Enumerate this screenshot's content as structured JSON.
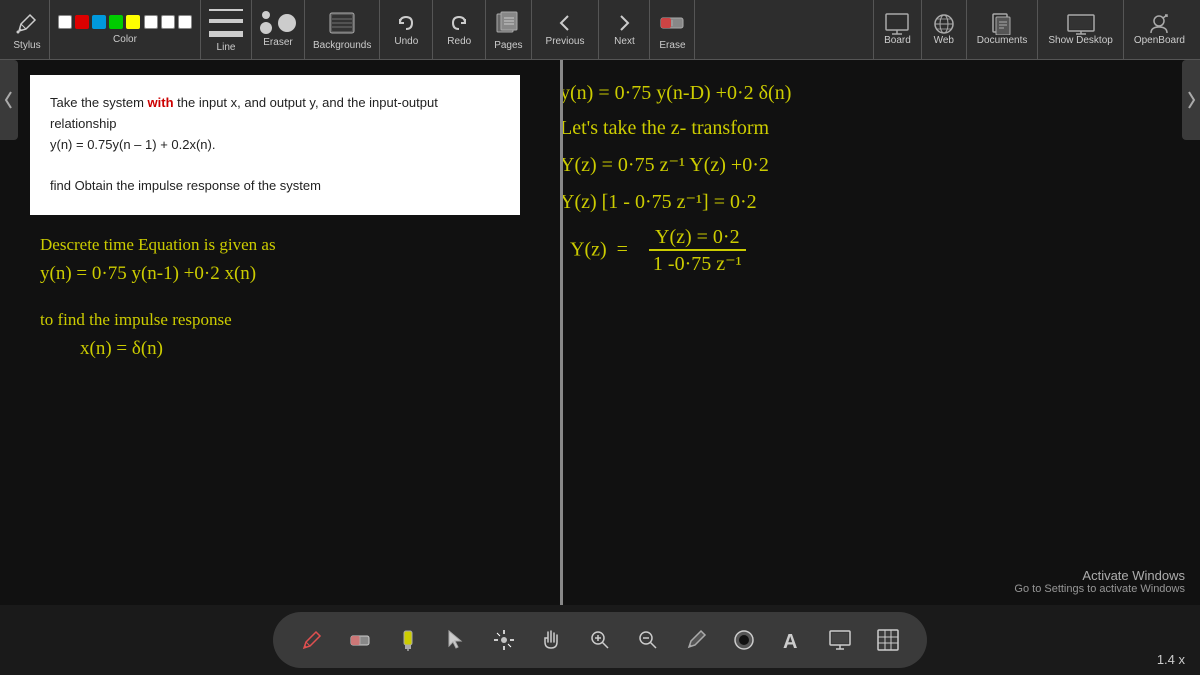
{
  "toolbar": {
    "stylus_label": "Stylus",
    "color_label": "Color",
    "line_label": "Line",
    "eraser_label": "Eraser",
    "backgrounds_label": "Backgrounds",
    "undo_label": "Undo",
    "redo_label": "Redo",
    "pages_label": "Pages",
    "previous_label": "Previous",
    "next_label": "Next",
    "erase_label": "Erase",
    "board_label": "Board",
    "web_label": "Web",
    "documents_label": "Documents",
    "show_desktop_label": "Show Desktop",
    "open_board_label": "OpenBoard",
    "colors": [
      "#ffffff",
      "#ff0000",
      "#00aaff",
      "#00cc00",
      "#ffff00"
    ],
    "colors2": [
      "#ffffff",
      "#ffffff",
      "#ffffff"
    ]
  },
  "text_box": {
    "line1": "Take the system with the input x, and output y, and the input-output",
    "line2": "relationship",
    "line3": "y(n) = 0.75y(n – 1) + 0.2x(n).",
    "line4": "find Obtain the impulse response of the system",
    "highlight_word": "with"
  },
  "left_handwritten": {
    "line1": "Descrete  time  Equation is given as",
    "line2": "y(n) = 0·75 y(n-1) +0·2 x(n)",
    "line3": "to  find  the  impulse  response",
    "line4": "x(n) = δ(n)"
  },
  "right_handwritten": {
    "line1": "y(n) = 0·75 y(n-D) +0·2 δ(n)",
    "line2": "Let's   take  the  z- transform",
    "line3": "Y(z) = 0·75 z⁻¹ Y(z) +0·2",
    "line4": "Y(z) [1 - 0·75 z⁻¹] = 0·2",
    "line5_num": "Y(z)  =  0·2",
    "line5_den": "1 -0·75 z⁻¹"
  },
  "bottom_tools": [
    {
      "name": "pen-tool",
      "icon": "✏️",
      "label": "pen"
    },
    {
      "name": "eraser-tool",
      "icon": "🧹",
      "label": "eraser"
    },
    {
      "name": "highlighter-tool",
      "icon": "🖊️",
      "label": "highlighter"
    },
    {
      "name": "pointer-tool",
      "icon": "↖️",
      "label": "pointer"
    },
    {
      "name": "laser-tool",
      "icon": "✳️",
      "label": "laser"
    },
    {
      "name": "hand-tool",
      "icon": "✋",
      "label": "hand"
    },
    {
      "name": "zoom-in-tool",
      "icon": "➕",
      "label": "zoom-in"
    },
    {
      "name": "zoom-out-tool",
      "icon": "🔍",
      "label": "zoom-out"
    },
    {
      "name": "select-tool",
      "icon": "✒️",
      "label": "select"
    },
    {
      "name": "circle-tool",
      "icon": "⬛",
      "label": "circle"
    },
    {
      "name": "text-tool",
      "icon": "🅰",
      "label": "text"
    },
    {
      "name": "screen-tool",
      "icon": "🖥️",
      "label": "screen"
    },
    {
      "name": "grid-tool",
      "icon": "▦",
      "label": "grid"
    }
  ],
  "activate_windows": {
    "title": "Activate Windows",
    "subtitle": "Go to Settings to activate Windows"
  },
  "zoom": {
    "value": "1.4 x"
  }
}
